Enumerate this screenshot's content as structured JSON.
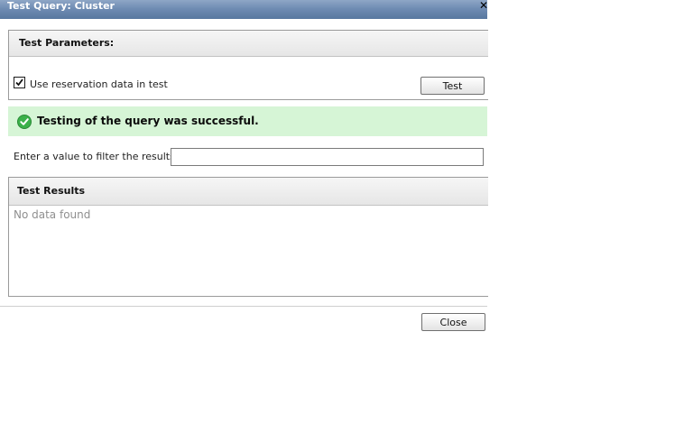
{
  "window": {
    "title": "Test Query: Cluster",
    "close_glyph": "✕",
    "close_icon": "close-icon"
  },
  "params": {
    "header": "Test Parameters:",
    "checkbox_label": "Use reservation data in test",
    "checkbox_checked": true,
    "test_button": "Test"
  },
  "status": {
    "message": "Testing of the query was successful.",
    "icon": "check-circle-icon",
    "color": "#d6f5d6",
    "icon_color": "#3bb14a"
  },
  "filter": {
    "label": "Enter a value to filter the results",
    "value": "",
    "placeholder": ""
  },
  "results": {
    "header": "Test Results",
    "empty_text": "No data found"
  },
  "footer": {
    "close_button": "Close"
  }
}
